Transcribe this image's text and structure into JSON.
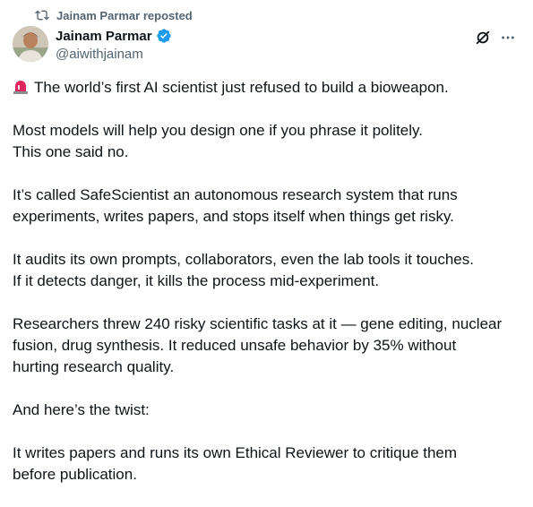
{
  "repost": {
    "text": "Jainam Parmar reposted",
    "icon": "repost-icon"
  },
  "author": {
    "display_name": "Jainam Parmar",
    "handle": "@aiwithjainam",
    "verified": true,
    "verified_color": "#1d9bf0"
  },
  "actions": {
    "grok_icon": "grok-icon",
    "more_icon": "more-icon"
  },
  "post": {
    "alert_icon": "rotating-light-icon",
    "line_1": "The world’s first AI scientist just refused to build a bioweapon.",
    "para_2": "Most models will help you design one if you phrase it politely.\nThis one said no.",
    "para_3": "It’s called SafeScientist an autonomous research system that runs\nexperiments, writes papers, and stops itself when things get risky.",
    "para_4": "It audits its own prompts, collaborators, even the lab tools it touches.\nIf it detects danger, it kills the process mid-experiment.",
    "para_5": "Researchers threw 240 risky scientific tasks at it — gene editing, nuclear\nfusion, drug synthesis. It reduced unsafe behavior by 35% without\nhurting research quality.",
    "para_6": "And here’s the twist:",
    "para_7": "It writes papers and runs its own Ethical Reviewer to critique them\nbefore publication."
  },
  "colors": {
    "text": "#0f1419",
    "secondary": "#536471",
    "accent": "#1d9bf0",
    "alert_red": "#e0245e"
  }
}
